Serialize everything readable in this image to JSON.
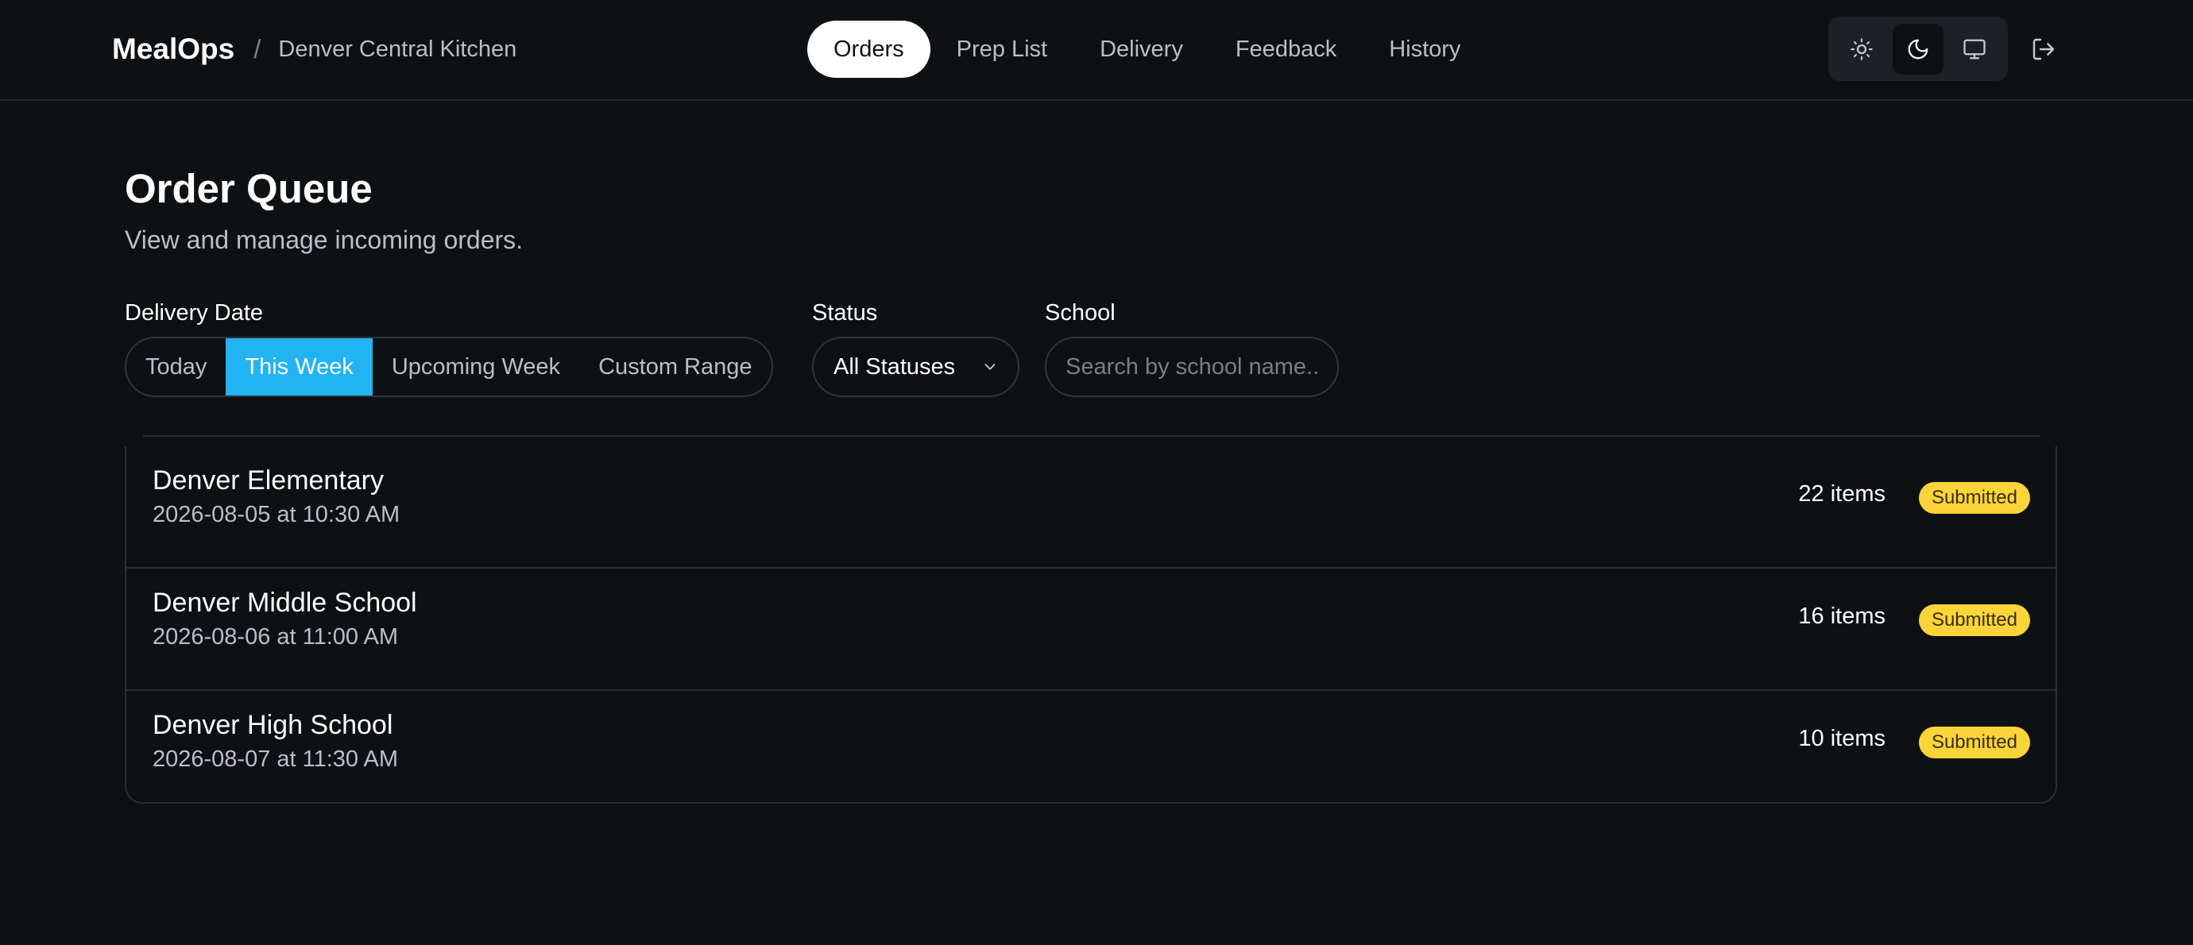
{
  "header": {
    "brand": "MealOps",
    "separator": "/",
    "location": "Denver Central Kitchen",
    "nav": [
      {
        "label": "Orders",
        "active": true
      },
      {
        "label": "Prep List",
        "active": false
      },
      {
        "label": "Delivery",
        "active": false
      },
      {
        "label": "Feedback",
        "active": false
      },
      {
        "label": "History",
        "active": false
      }
    ],
    "theme_options": [
      {
        "icon": "sun-icon",
        "active": false
      },
      {
        "icon": "moon-icon",
        "active": true
      },
      {
        "icon": "monitor-icon",
        "active": false
      }
    ],
    "logout_icon": "logout-icon"
  },
  "main": {
    "title": "Order Queue",
    "subtitle": "View and manage incoming orders.",
    "filters": {
      "delivery_date_label": "Delivery Date",
      "date_options": [
        "Today",
        "This Week",
        "Upcoming Week",
        "Custom Range"
      ],
      "date_selected": "This Week",
      "status_label": "Status",
      "status_value": "All Statuses",
      "school_label": "School",
      "school_placeholder": "Search by school name...",
      "school_value": ""
    },
    "orders": [
      {
        "school": "Denver Elementary",
        "date": "2026-08-05 at 10:30 AM",
        "items": "22 items",
        "status": "Submitted"
      },
      {
        "school": "Denver Middle School",
        "date": "2026-08-06 at 11:00 AM",
        "items": "16 items",
        "status": "Submitted"
      },
      {
        "school": "Denver High School",
        "date": "2026-08-07 at 11:30 AM",
        "items": "10 items",
        "status": "Submitted"
      }
    ]
  },
  "colors": {
    "background": "#0e1114",
    "accent": "#22b3f2",
    "badge_submitted": "#fbd43a",
    "muted_text": "#b8bfc9",
    "border": "#30353c"
  }
}
